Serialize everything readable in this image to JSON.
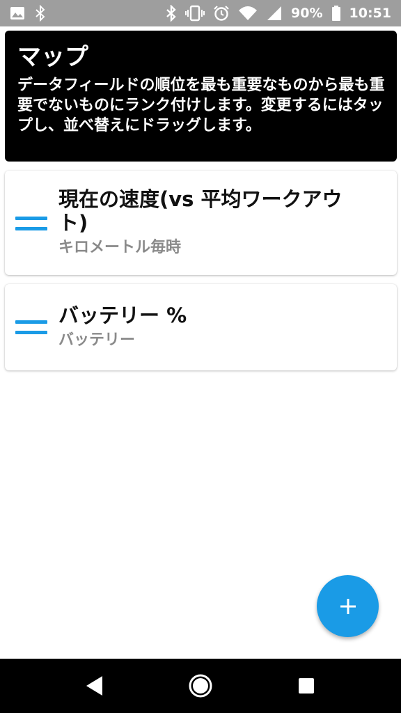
{
  "status_bar": {
    "battery_percent": "90%",
    "time": "10:51",
    "icons": [
      "image-icon",
      "bluetooth-icon",
      "bluetooth-icon",
      "vibrate-icon",
      "alarm-icon",
      "wifi-icon",
      "signal-icon",
      "battery-icon"
    ]
  },
  "header": {
    "title": "マップ",
    "description": "データフィールドの順位を最も重要なものから最も重要でないものにランク付けします。変更するにはタップし、並べ替えにドラッグします。"
  },
  "fields": [
    {
      "title": "現在の速度(vs 平均ワークアウト)",
      "subtitle": "キロメートル毎時"
    },
    {
      "title": "バッテリー %",
      "subtitle": "バッテリー"
    }
  ],
  "fab": {
    "icon": "plus-icon"
  },
  "nav_bar": {
    "icons": [
      "back-icon",
      "home-icon",
      "recents-icon"
    ]
  },
  "colors": {
    "accent": "#1a9be6",
    "header_bg": "#000000",
    "status_bar_bg": "#9e9e9e",
    "subtitle": "#8a8a8a"
  }
}
